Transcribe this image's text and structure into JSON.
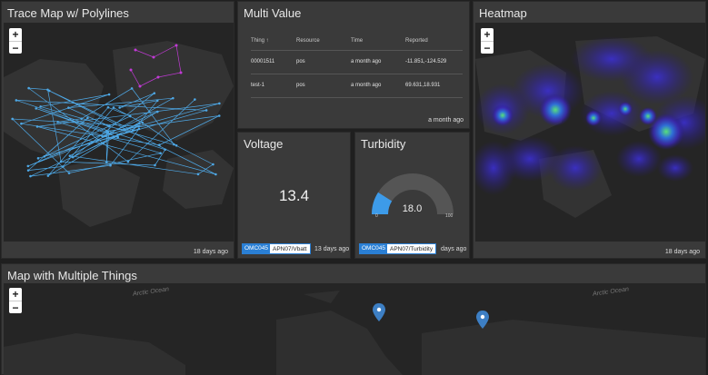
{
  "trace_map": {
    "title": "Trace Map w/ Polylines",
    "updated": "18 days ago",
    "zoom_in": "+",
    "zoom_out": "−"
  },
  "multi_value": {
    "title": "Multi Value",
    "columns": [
      "Thing ↑",
      "Resource",
      "Time",
      "Reported"
    ],
    "rows": [
      [
        "00001511",
        "pos",
        "a month ago",
        "-11.851,-124.529"
      ],
      [
        "test-1",
        "pos",
        "a month ago",
        "69.631,18.931"
      ]
    ],
    "updated": "a month ago"
  },
  "voltage": {
    "title": "Voltage",
    "value": "13.4",
    "tag_thing": "OMC045",
    "tag_resource": "APN07/Vbatt",
    "updated": "13 days ago"
  },
  "turbidity": {
    "title": "Turbidity",
    "value": "18.0",
    "min": "0",
    "max": "100",
    "level": 0.18,
    "tag_thing": "OMC045",
    "tag_resource": "APN07/Turbidity",
    "updated": "days ago",
    "accent": "#3d9be9"
  },
  "heatmap": {
    "title": "Heatmap",
    "updated": "18 days ago",
    "zoom_in": "+",
    "zoom_out": "−"
  },
  "multi_map": {
    "title": "Map with Multiple Things",
    "zoom_in": "+",
    "zoom_out": "−",
    "ocean_label_left": "Arctic Ocean",
    "ocean_label_right": "Arctic Ocean",
    "marker_color": "#3d7fc4"
  },
  "colors": {
    "polyline": "#4ea8e6",
    "polyline_secondary": "#c23ad6",
    "panel": "#3a3a3a",
    "map": "#252525"
  }
}
